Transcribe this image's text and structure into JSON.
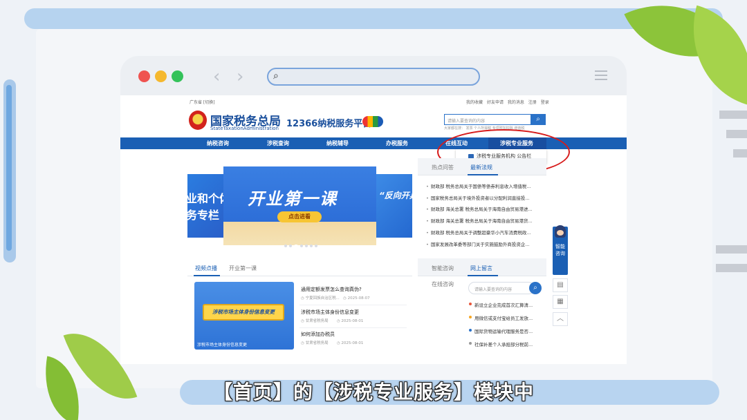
{
  "browser": {
    "window_controls": [
      "close",
      "minimize",
      "maximize"
    ],
    "nav_icons": [
      "back-arrow-icon",
      "forward-arrow-icon"
    ],
    "address_icon": "search-icon",
    "menu_icon": "hamburger-icon",
    "colors": {
      "close": "#ef5350",
      "minimize": "#f5b82e",
      "maximize": "#34c25a"
    }
  },
  "site": {
    "location": "广东省 [切换]",
    "top_links": [
      "我的收藏",
      "好友申请",
      "我的消息",
      "注册",
      "登录"
    ],
    "logo_title": "国家税务总局",
    "logo_subtitle": "StateTaxationAdministration",
    "platform": "12366纳税服务平台",
    "search": {
      "placeholder": "请输入要查询的内容",
      "hot": "大家都在搜：  发票  个人所得税  专项附加扣除  增值税"
    },
    "nav": [
      "纳税咨询",
      "涉税查询",
      "纳税辅导",
      "办税服务",
      "在线互动",
      "涉税专业服务"
    ],
    "active_nav": "涉税专业服务",
    "dropdown": {
      "item": "涉税专业服务机构 公告栏"
    },
    "banner": {
      "title": "开业第一课",
      "button": "点击进看",
      "left_text": [
        "业和个体",
        "务专栏"
      ],
      "right_text": "“反向开具"
    },
    "news": {
      "tabs": [
        "热点问答",
        "最新法规"
      ],
      "active": "最新法规",
      "items": [
        "财政部 税务总局关于国债等债券利息收入增值税...",
        "国家税务总局关于境外投资者以分配利润直接投...",
        "财政部 海关总署 税务总局关于海南自由贸易港进...",
        "财政部 海关总署 税务总局关于海南自由贸易港货...",
        "财政部 税务总局关于调整超豪华小汽车消费税政...",
        "国家发展改革委等部门关于实施鼓励外商投资企..."
      ]
    },
    "video": {
      "tabs": [
        "视频点播",
        "开业第一课"
      ],
      "active": "视频点播",
      "board_text": "涉税市场主体身份信息变更",
      "caption": "涉税市场主体身份信息变更",
      "items": [
        {
          "title": "通用定额发票怎么查询真伪?",
          "source": "宁夏回族自治区税...",
          "date": "2025-08-07"
        },
        {
          "title": "涉税市场主体身份信息变更",
          "source": "甘肃省税务局",
          "date": "2025-08-01"
        },
        {
          "title": "如何添加办税员",
          "source": "甘肃省税务局",
          "date": "2025-08-01"
        }
      ]
    },
    "consult": {
      "tabs": [
        "智能咨询",
        "网上留言"
      ],
      "active": "网上留言",
      "online_label": "在线咨询",
      "placeholder": "请输入要查询的内容",
      "items": [
        {
          "text": "新设立企业完成首次汇算清...",
          "color": "#e8563a"
        },
        {
          "text": "用微信或支付宝给员工发放...",
          "color": "#f5a623"
        },
        {
          "text": "国际货物运输代理服务是否...",
          "color": "#2a72c8"
        },
        {
          "text": "社保补差个人承担部分税前...",
          "color": "#999999"
        }
      ]
    },
    "assistant": {
      "label": "智能咨询",
      "float_icons": [
        "book-icon",
        "qrcode-icon",
        "back-to-top-icon"
      ]
    }
  },
  "subtitle": "【首页】的【涉税专业服务】模块中"
}
